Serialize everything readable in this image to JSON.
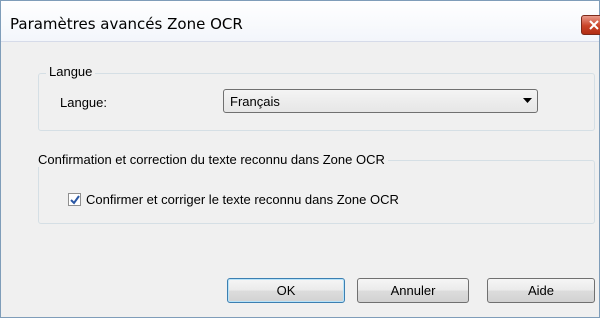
{
  "window": {
    "title": "Paramètres avancés Zone OCR"
  },
  "icons": {
    "close": "close-x-icon",
    "dropdown": "chevron-down-icon",
    "check": "checkmark-icon"
  },
  "colors": {
    "close_button": "#c94328",
    "default_button_border": "#3c7fb1"
  },
  "language_group": {
    "legend": "Langue",
    "label": "Langue:",
    "selected": "Français"
  },
  "confirm_group": {
    "legend": "Confirmation et correction du texte reconnu dans Zone OCR",
    "checkbox_label": "Confirmer et corriger le texte reconnu dans Zone OCR",
    "checked": true
  },
  "buttons": {
    "ok": "OK",
    "cancel": "Annuler",
    "help": "Aide"
  }
}
